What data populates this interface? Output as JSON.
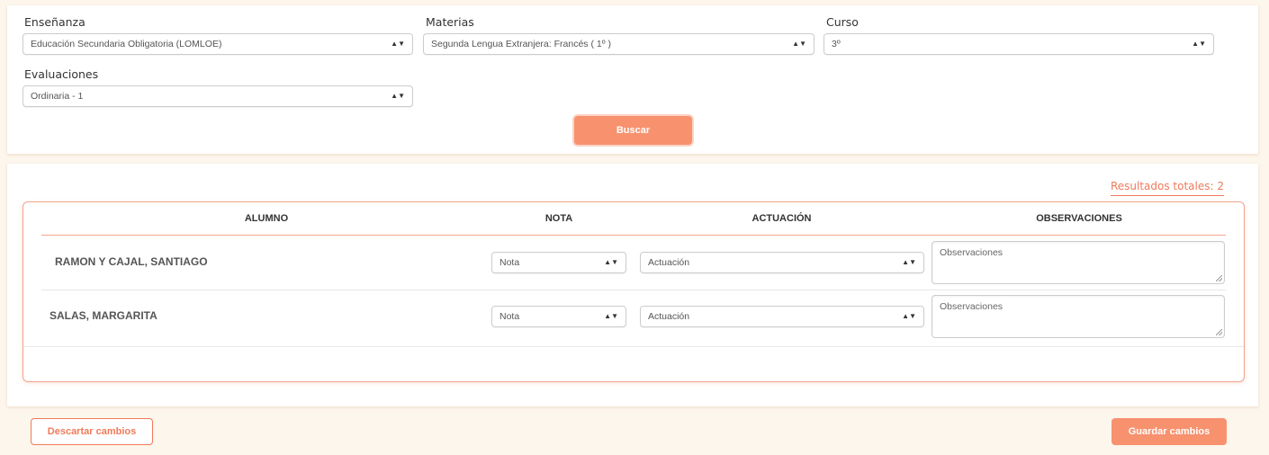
{
  "filters": {
    "ensenanza": {
      "label": "Enseñanza",
      "value": "Educación Secundaria Obligatoria (LOMLOE)"
    },
    "materias": {
      "label": "Materias",
      "value": "Segunda Lengua Extranjera: Francés ( 1º )"
    },
    "curso": {
      "label": "Curso",
      "value": "3º"
    },
    "evaluaciones": {
      "label": "Evaluaciones",
      "value": "Ordinaria - 1"
    },
    "search_label": "Buscar"
  },
  "results": {
    "total_text": "Resultados totales: 2",
    "columns": [
      "ALUMNO",
      "NOTA",
      "ACTUACIÓN",
      "OBSERVACIONES"
    ],
    "rows": [
      {
        "student": "RAMON Y CAJAL, SANTIAGO",
        "nota_placeholder": "Nota",
        "actuacion_placeholder": "Actuación",
        "observaciones_placeholder": "Observaciones"
      },
      {
        "student": "SALAS, MARGARITA",
        "nota_placeholder": "Nota",
        "actuacion_placeholder": "Actuación",
        "observaciones_placeholder": "Observaciones"
      }
    ]
  },
  "footer": {
    "discard_label": "Descartar cambios",
    "save_label": "Guardar cambios"
  },
  "colors": {
    "accent": "#f7916e",
    "accent_text": "#f07a5a",
    "page_background": "#fdf6ec"
  },
  "icons": {
    "select_caret": "up-down-caret-icon",
    "textarea_resize": "resize-grip-icon"
  }
}
